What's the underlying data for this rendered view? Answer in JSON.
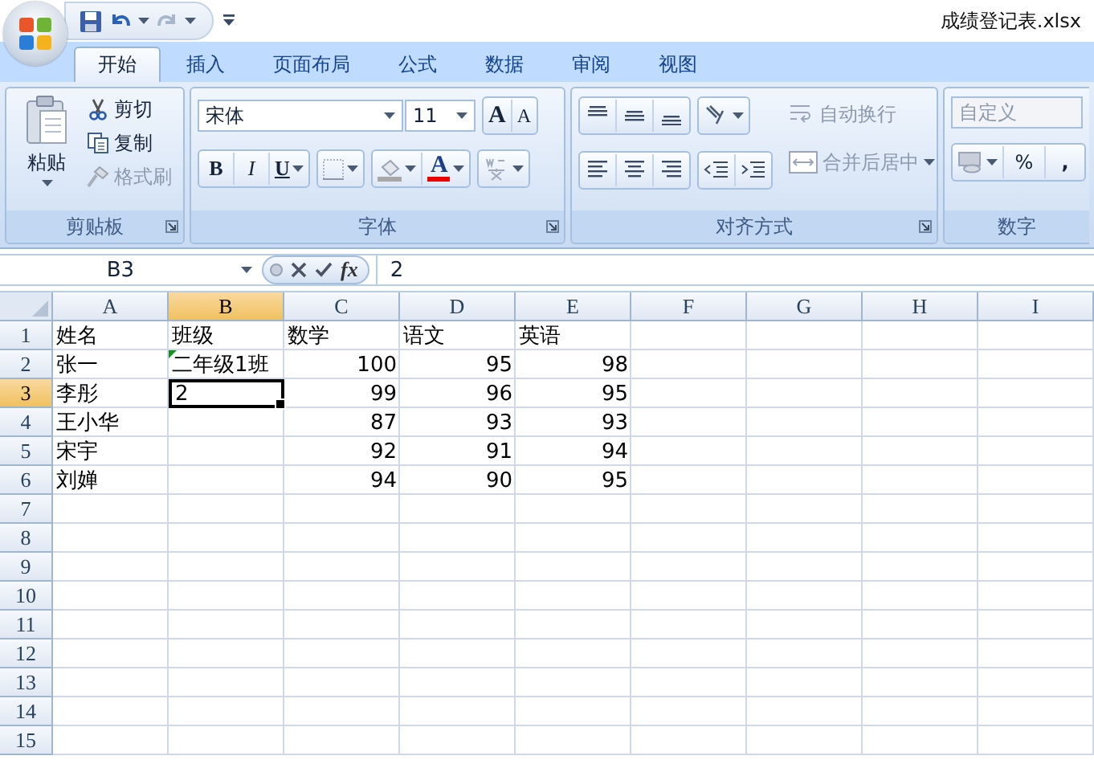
{
  "title_bar": {
    "title": "成绩登记表.xlsx"
  },
  "tabs": [
    {
      "label": "开始",
      "selected": true
    },
    {
      "label": "插入",
      "selected": false
    },
    {
      "label": "页面布局",
      "selected": false
    },
    {
      "label": "公式",
      "selected": false
    },
    {
      "label": "数据",
      "selected": false
    },
    {
      "label": "审阅",
      "selected": false
    },
    {
      "label": "视图",
      "selected": false
    }
  ],
  "ribbon": {
    "clipboard": {
      "label": "剪贴板",
      "paste": "粘贴",
      "actions": [
        {
          "kind": "cut",
          "label": "剪切",
          "disabled": false
        },
        {
          "kind": "copy",
          "label": "复制",
          "disabled": false
        },
        {
          "kind": "painter",
          "label": "格式刷",
          "disabled": true
        }
      ]
    },
    "font": {
      "label": "字体",
      "font_name": "宋体",
      "font_size": "11",
      "grow": "A",
      "shrink": "A",
      "bold": "B",
      "italic": "I",
      "underline": "U",
      "font_color": "A"
    },
    "alignment": {
      "label": "对齐方式",
      "wrap": {
        "label": "自动换行",
        "disabled": true
      },
      "merge": {
        "label": "合并后居中",
        "disabled": true
      }
    },
    "number": {
      "label": "数字",
      "format": "自定义",
      "percent": "%",
      "comma": ","
    }
  },
  "formula_bar": {
    "name_box": "B3",
    "function_label": "fx",
    "value": "2"
  },
  "columns": [
    {
      "label": "A",
      "selected": false
    },
    {
      "label": "B",
      "selected": true
    },
    {
      "label": "C",
      "selected": false
    },
    {
      "label": "D",
      "selected": false
    },
    {
      "label": "E",
      "selected": false
    },
    {
      "label": "F",
      "selected": false
    },
    {
      "label": "G",
      "selected": false
    },
    {
      "label": "H",
      "selected": false
    },
    {
      "label": "I",
      "selected": false
    }
  ],
  "rows": [
    {
      "number": "1",
      "selected": false,
      "cells": [
        {
          "value": "姓名",
          "kind": "text"
        },
        {
          "value": "班级",
          "kind": "text"
        },
        {
          "value": "数学",
          "kind": "text"
        },
        {
          "value": "语文",
          "kind": "text"
        },
        {
          "value": "英语",
          "kind": "text"
        }
      ]
    },
    {
      "number": "2",
      "selected": false,
      "cells": [
        {
          "value": "张一",
          "kind": "text"
        },
        {
          "value": "二年级1班",
          "kind": "text",
          "flag": true
        },
        {
          "value": "100",
          "kind": "number"
        },
        {
          "value": "95",
          "kind": "number"
        },
        {
          "value": "98",
          "kind": "number"
        }
      ]
    },
    {
      "number": "3",
      "selected": true,
      "cells": [
        {
          "value": "李彤",
          "kind": "text"
        },
        {
          "value": "2",
          "kind": "text",
          "active": true
        },
        {
          "value": "99",
          "kind": "number"
        },
        {
          "value": "96",
          "kind": "number"
        },
        {
          "value": "95",
          "kind": "number"
        }
      ]
    },
    {
      "number": "4",
      "selected": false,
      "cells": [
        {
          "value": "王小华",
          "kind": "text"
        },
        null,
        {
          "value": "87",
          "kind": "number"
        },
        {
          "value": "93",
          "kind": "number"
        },
        {
          "value": "93",
          "kind": "number"
        }
      ]
    },
    {
      "number": "5",
      "selected": false,
      "cells": [
        {
          "value": "宋宇",
          "kind": "text"
        },
        null,
        {
          "value": "92",
          "kind": "number"
        },
        {
          "value": "91",
          "kind": "number"
        },
        {
          "value": "94",
          "kind": "number"
        }
      ]
    },
    {
      "number": "6",
      "selected": false,
      "cells": [
        {
          "value": "刘婵",
          "kind": "text"
        },
        null,
        {
          "value": "94",
          "kind": "number"
        },
        {
          "value": "90",
          "kind": "number"
        },
        {
          "value": "95",
          "kind": "number"
        }
      ]
    },
    {
      "number": "7",
      "selected": false,
      "cells": []
    },
    {
      "number": "8",
      "selected": false,
      "cells": []
    },
    {
      "number": "9",
      "selected": false,
      "cells": []
    },
    {
      "number": "10",
      "selected": false,
      "cells": []
    },
    {
      "number": "11",
      "selected": false,
      "cells": []
    },
    {
      "number": "12",
      "selected": false,
      "cells": []
    },
    {
      "number": "13",
      "selected": false,
      "cells": []
    },
    {
      "number": "14",
      "selected": false,
      "cells": []
    },
    {
      "number": "15",
      "selected": false,
      "cells": []
    }
  ]
}
